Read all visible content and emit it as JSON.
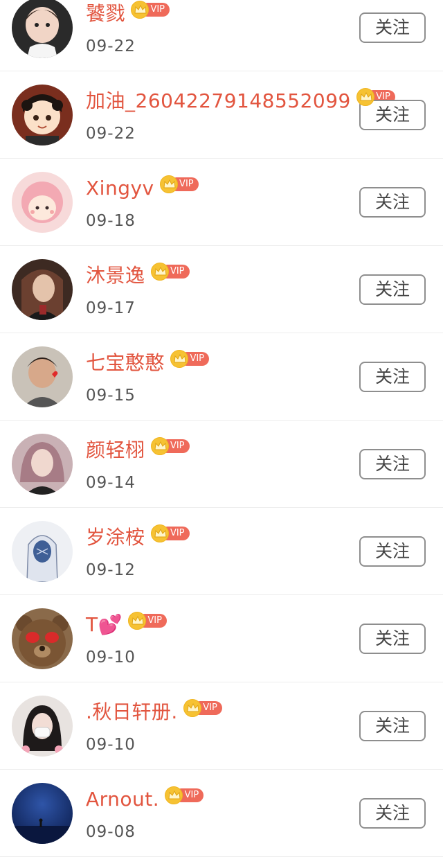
{
  "follow_label": "关注",
  "vip_label": "VIP",
  "users": [
    {
      "name": "饕戮",
      "date": "09-22",
      "avatar": "avatar-girl-doll"
    },
    {
      "name": "加油_26042279148552099",
      "date": "09-22",
      "avatar": "avatar-cartoon-girl"
    },
    {
      "name": "Xingyv",
      "date": "09-18",
      "avatar": "avatar-pink-anime"
    },
    {
      "name": "沐景逸",
      "date": "09-17",
      "avatar": "avatar-portrait"
    },
    {
      "name": "七宝憨憨",
      "date": "09-15",
      "avatar": "avatar-boy-heart"
    },
    {
      "name": "颜轻栩",
      "date": "09-14",
      "avatar": "avatar-girl-pink-hair"
    },
    {
      "name": "岁涂桉",
      "date": "09-12",
      "avatar": "avatar-hoodie-sketch"
    },
    {
      "name": "T💕",
      "date": "09-10",
      "avatar": "avatar-teddy-bear"
    },
    {
      "name": ".秋日轩册.",
      "date": "09-10",
      "avatar": "avatar-girl-mask"
    },
    {
      "name": "Arnout.",
      "date": "09-08",
      "avatar": "avatar-blue-night"
    }
  ]
}
